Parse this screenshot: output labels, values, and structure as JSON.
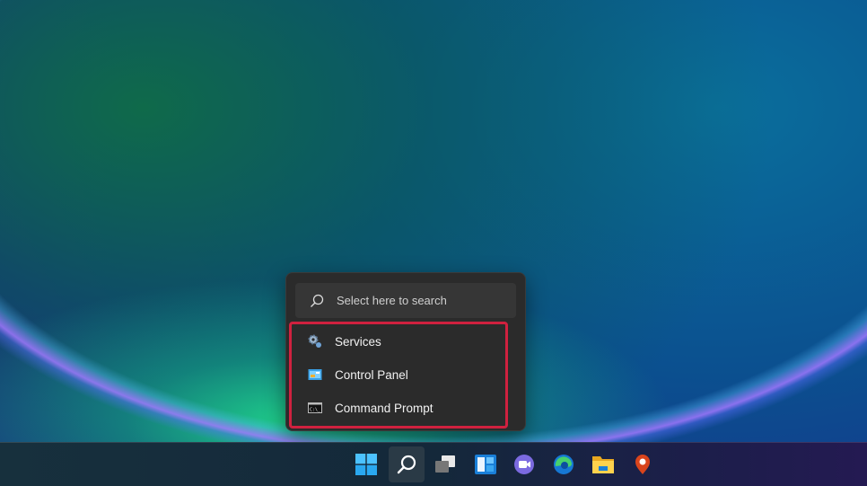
{
  "flyout": {
    "search_placeholder": "Select here to search",
    "items": [
      {
        "label": "Services",
        "icon": "gears-icon"
      },
      {
        "label": "Control Panel",
        "icon": "control-panel-icon"
      },
      {
        "label": "Command Prompt",
        "icon": "command-prompt-icon"
      }
    ],
    "highlight_color": "#d0213f"
  },
  "taskbar": {
    "icons": [
      "start",
      "search",
      "task-view",
      "widgets",
      "chat",
      "edge",
      "file-explorer",
      "maps"
    ]
  }
}
